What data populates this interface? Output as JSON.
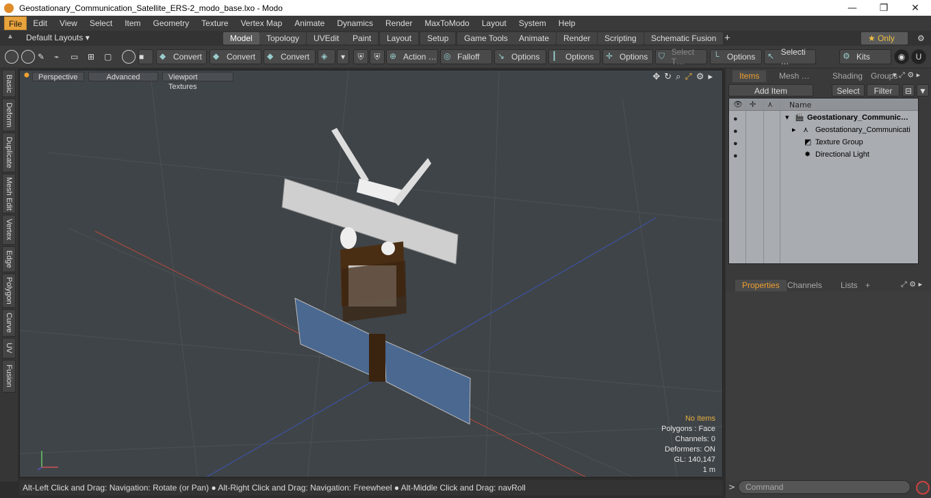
{
  "window": {
    "title": "Geostationary_Communication_Satellite_ERS-2_modo_base.lxo - Modo",
    "minimize": "—",
    "maximize": "❐",
    "close": "✕"
  },
  "menu": [
    "File",
    "Edit",
    "View",
    "Select",
    "Item",
    "Geometry",
    "Texture",
    "Vertex Map",
    "Animate",
    "Dynamics",
    "Render",
    "MaxToModo",
    "Layout",
    "System",
    "Help"
  ],
  "layouts": {
    "label": "Default Layouts ▾"
  },
  "tabs": [
    "Model",
    "Topology",
    "UVEdit",
    "Paint",
    "Layout",
    "Setup",
    "Game Tools",
    "Animate",
    "Render",
    "Scripting",
    "Schematic Fusion"
  ],
  "tabs_selected": "Model",
  "tabs_add": "+",
  "only": "★  Only",
  "toolbar": {
    "convert1": "Convert",
    "convert2": "Convert",
    "convert3": "Convert",
    "action": "Action  …",
    "falloff": "Falloff",
    "options1": "Options",
    "options2": "Options",
    "options3": "Options",
    "select_t": "Select T…",
    "options4": "Options",
    "selecti": "Selecti …",
    "kits": "Kits"
  },
  "left_tabs": [
    "Basic",
    "Deform",
    "Duplicate",
    "Mesh Edit",
    "Vertex",
    "Edge",
    "Polygon",
    "Curve",
    "UV",
    "Fusion"
  ],
  "viewport": {
    "perspective": "Perspective",
    "advanced": "Advanced",
    "textures": "Viewport Textures",
    "stats": {
      "noitems": "No Items",
      "polygons": "Polygons : Face",
      "channels": "Channels: 0",
      "deformers": "Deformers: ON",
      "gl": "GL: 140,147",
      "scale": "1 m"
    }
  },
  "status": "Alt-Left Click and Drag: Navigation: Rotate (or Pan) ● Alt-Right Click and Drag: Navigation: Freewheel ● Alt-Middle Click and Drag: navRoll",
  "items_panel": {
    "tabs": [
      "Items",
      "Mesh …",
      "Shading",
      "Groups"
    ],
    "add_item": "Add Item",
    "select": "Select",
    "filter": "Filter",
    "name_header": "Name",
    "rows": [
      "Geostationary_Communic…",
      "Geostationary_Communicati …",
      "Texture Group",
      "Directional Light"
    ]
  },
  "props_panel": {
    "tabs": [
      "Properties",
      "Channels",
      "Lists"
    ],
    "add": "+"
  },
  "command": {
    "placeholder": "Command"
  }
}
